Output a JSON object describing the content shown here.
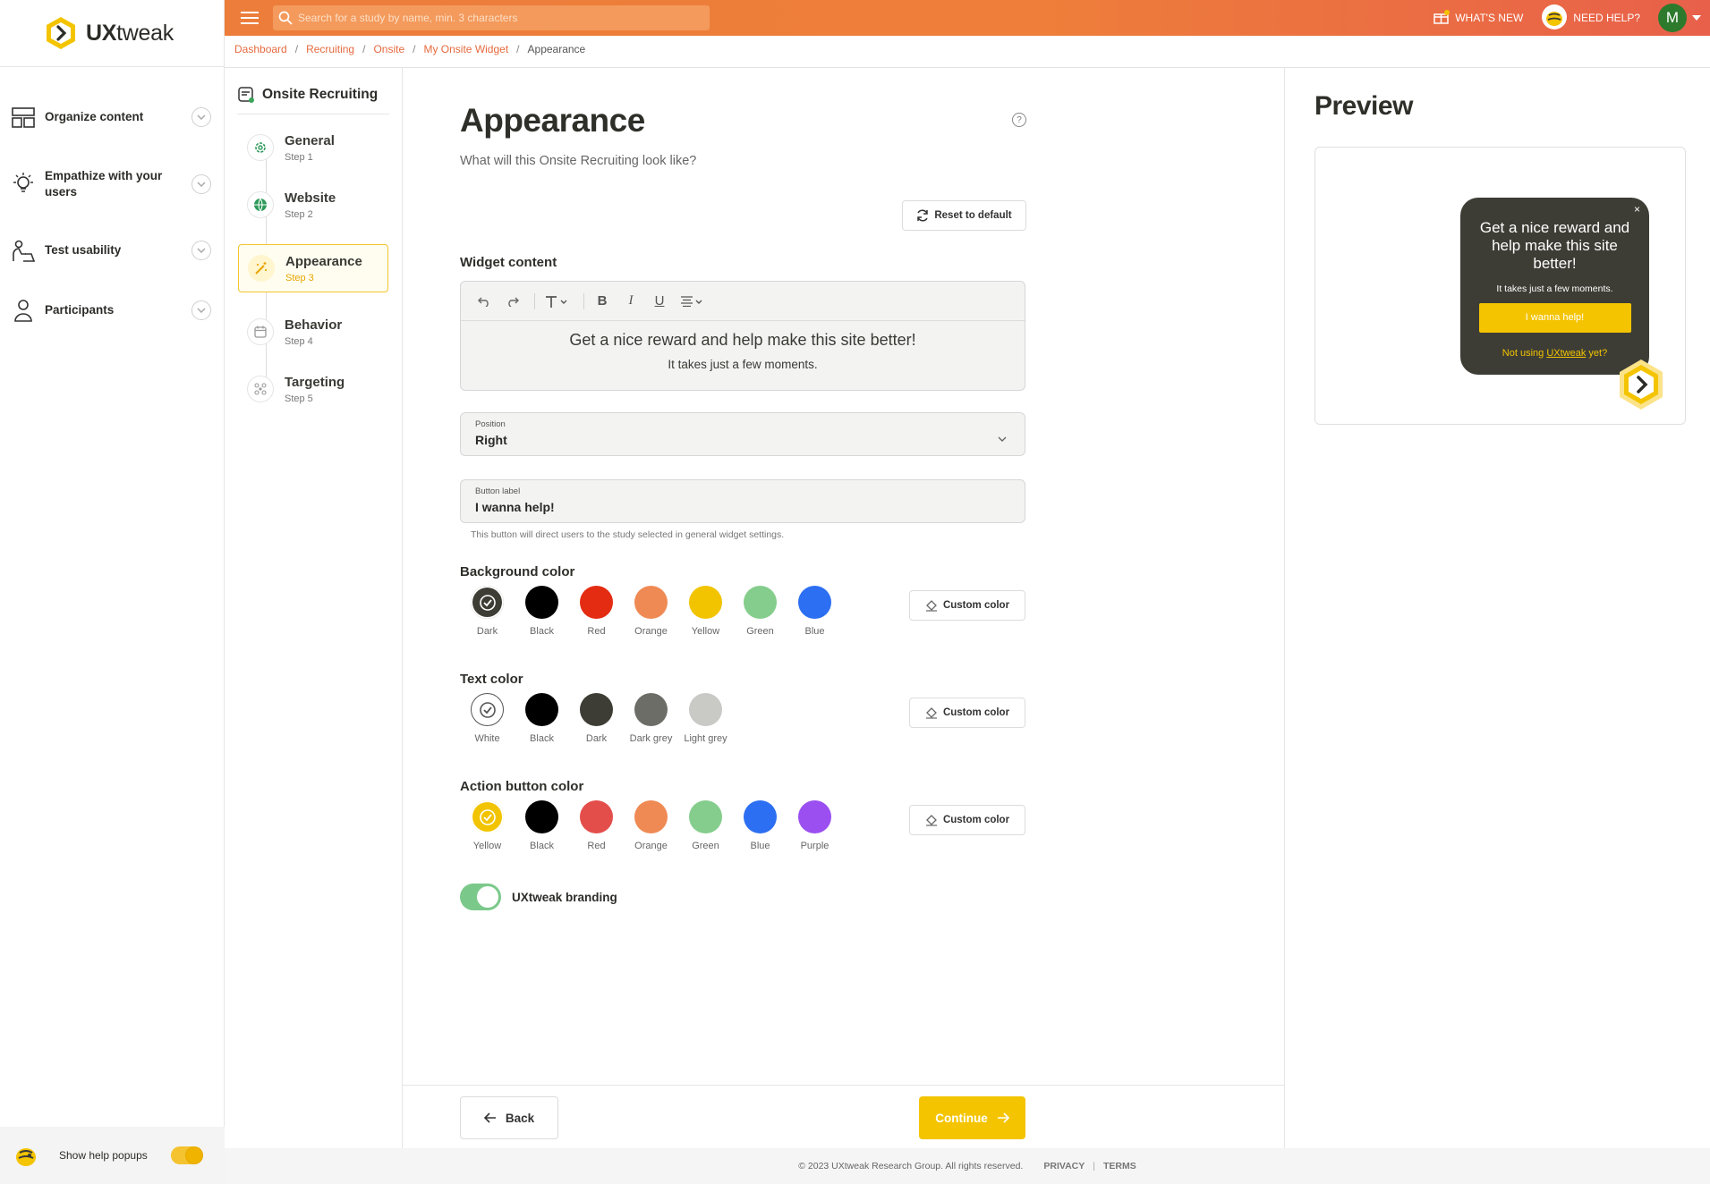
{
  "app": {
    "logo_text": "UXtweak",
    "logo_bold": "UX",
    "logo_light": "tweak"
  },
  "topbar": {
    "search_placeholder": "Search for a study by name, min. 3 characters",
    "whats_new": "WHAT'S NEW",
    "need_help": "NEED HELP?",
    "avatar_initial": "M"
  },
  "breadcrumb": {
    "items": [
      "Dashboard",
      "Recruiting",
      "Onsite",
      "My Onsite Widget"
    ],
    "current": "Appearance"
  },
  "leftnav": {
    "items": [
      {
        "label": "Organize content"
      },
      {
        "label": "Empathize with your users"
      },
      {
        "label": "Test usability"
      },
      {
        "label": "Participants"
      }
    ],
    "help_popups_label": "Show help popups"
  },
  "steps": {
    "title": "Onsite Recruiting",
    "items": [
      {
        "name": "General",
        "step": "Step 1"
      },
      {
        "name": "Website",
        "step": "Step 2"
      },
      {
        "name": "Appearance",
        "step": "Step 3"
      },
      {
        "name": "Behavior",
        "step": "Step 4"
      },
      {
        "name": "Targeting",
        "step": "Step 5"
      }
    ]
  },
  "form": {
    "title": "Appearance",
    "help_symbol": "?",
    "subtitle": "What will this Onsite Recruiting look like?",
    "reset_label": "Reset to default",
    "widget_content_label": "Widget content",
    "editor_heading": "Get a nice reward and help make this site better!",
    "editor_sub": "It takes just a few moments.",
    "position_label": "Position",
    "position_value": "Right",
    "button_label_label": "Button label",
    "button_label_value": "I wanna help!",
    "button_hint": "This button will direct users to the study selected in general widget settings.",
    "custom_color": "Custom color",
    "background_color": {
      "label": "Background color",
      "swatches": [
        {
          "name": "Dark",
          "color": "#3d3d35",
          "selected": true
        },
        {
          "name": "Black",
          "color": "#000000"
        },
        {
          "name": "Red",
          "color": "#e32c12"
        },
        {
          "name": "Orange",
          "color": "#ef8a55"
        },
        {
          "name": "Yellow",
          "color": "#f2c400"
        },
        {
          "name": "Green",
          "color": "#85cd8c"
        },
        {
          "name": "Blue",
          "color": "#2d6ff2"
        }
      ]
    },
    "text_color": {
      "label": "Text color",
      "swatches": [
        {
          "name": "White",
          "color": "#ffffff",
          "selected": true
        },
        {
          "name": "Black",
          "color": "#000000"
        },
        {
          "name": "Dark",
          "color": "#3d3d35"
        },
        {
          "name": "Dark grey",
          "color": "#6d6d68"
        },
        {
          "name": "Light grey",
          "color": "#c9c9c6"
        }
      ]
    },
    "action_button_color": {
      "label": "Action button color",
      "swatches": [
        {
          "name": "Yellow",
          "color": "#f2c400",
          "selected": true
        },
        {
          "name": "Black",
          "color": "#000000"
        },
        {
          "name": "Red",
          "color": "#e34e4b"
        },
        {
          "name": "Orange",
          "color": "#ef8a55"
        },
        {
          "name": "Green",
          "color": "#85cd8c"
        },
        {
          "name": "Blue",
          "color": "#2d6ff2"
        },
        {
          "name": "Purple",
          "color": "#9b4ff0"
        }
      ]
    },
    "branding_label": "UXtweak branding",
    "back_label": "Back",
    "continue_label": "Continue"
  },
  "preview": {
    "title": "Preview",
    "widget_close": "×",
    "widget_heading": "Get a nice reward and help make this site better!",
    "widget_sub": "It takes just a few moments.",
    "widget_button": "I wanna help!",
    "widget_foot_pre": "Not using ",
    "widget_foot_link": "UXtweak",
    "widget_foot_post": " yet?"
  },
  "footer": {
    "copyright": "© 2023 UXtweak Research Group. All rights reserved.",
    "privacy": "PRIVACY",
    "terms": "TERMS"
  },
  "colors": {
    "accent": "#f4c400",
    "brand_orange": "#ec7d3b",
    "link": "#e56a3e"
  }
}
